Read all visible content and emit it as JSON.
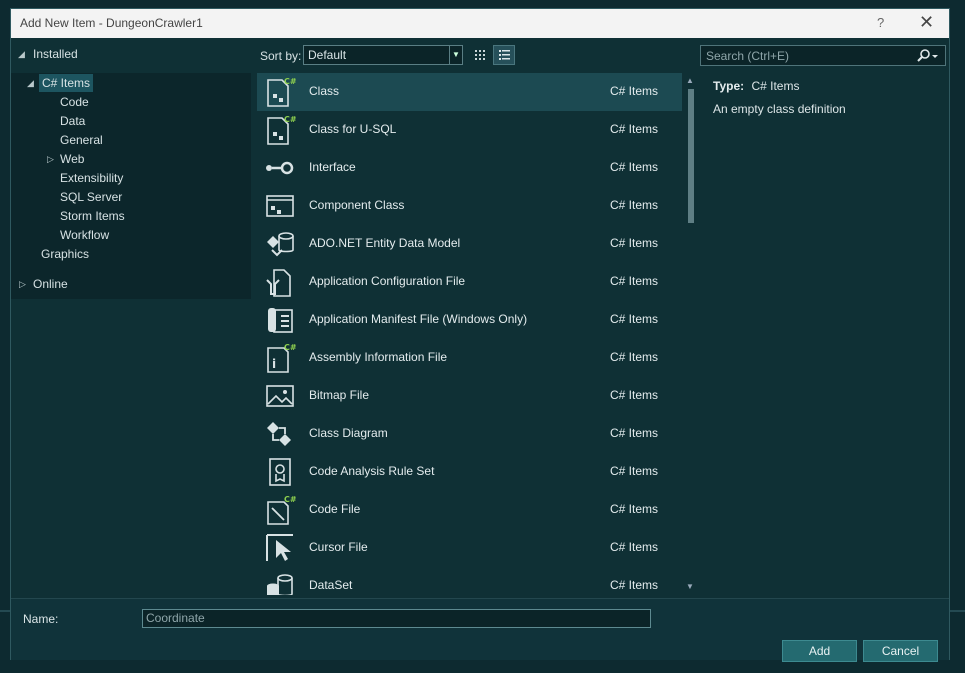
{
  "window": {
    "title": "Add New Item - DungeonCrawler1",
    "help": "?",
    "close": "✕"
  },
  "tree": {
    "installed": "Installed",
    "csharp_items": "C# Items",
    "children": [
      "Code",
      "Data",
      "General",
      "Web",
      "Extensibility",
      "SQL Server",
      "Storm Items",
      "Workflow"
    ],
    "graphics": "Graphics",
    "online": "Online"
  },
  "toolbar": {
    "sort_label": "Sort by:",
    "sort_value": "Default"
  },
  "search": {
    "placeholder": "Search (Ctrl+E)"
  },
  "items": [
    {
      "name": "Class",
      "category": "C# Items",
      "icon": "class-icon"
    },
    {
      "name": "Class for U-SQL",
      "category": "C# Items",
      "icon": "class-usql-icon"
    },
    {
      "name": "Interface",
      "category": "C# Items",
      "icon": "interface-icon"
    },
    {
      "name": "Component Class",
      "category": "C# Items",
      "icon": "component-class-icon"
    },
    {
      "name": "ADO.NET Entity Data Model",
      "category": "C# Items",
      "icon": "entity-data-model-icon"
    },
    {
      "name": "Application Configuration File",
      "category": "C# Items",
      "icon": "config-file-icon"
    },
    {
      "name": "Application Manifest File (Windows Only)",
      "category": "C# Items",
      "icon": "manifest-file-icon"
    },
    {
      "name": "Assembly Information File",
      "category": "C# Items",
      "icon": "assembly-info-icon"
    },
    {
      "name": "Bitmap File",
      "category": "C# Items",
      "icon": "bitmap-icon"
    },
    {
      "name": "Class Diagram",
      "category": "C# Items",
      "icon": "class-diagram-icon"
    },
    {
      "name": "Code Analysis Rule Set",
      "category": "C# Items",
      "icon": "rule-set-icon"
    },
    {
      "name": "Code File",
      "category": "C# Items",
      "icon": "code-file-icon"
    },
    {
      "name": "Cursor File",
      "category": "C# Items",
      "icon": "cursor-file-icon"
    },
    {
      "name": "DataSet",
      "category": "C# Items",
      "icon": "dataset-icon"
    }
  ],
  "details": {
    "type_label": "Type:",
    "type_value": "C# Items",
    "description": "An empty class definition"
  },
  "footer": {
    "name_label": "Name:",
    "name_value": "Coordinate",
    "add": "Add",
    "cancel": "Cancel"
  },
  "colors": {
    "accent": "#246a70",
    "background": "#0f3035",
    "selected": "#1c4a52"
  }
}
